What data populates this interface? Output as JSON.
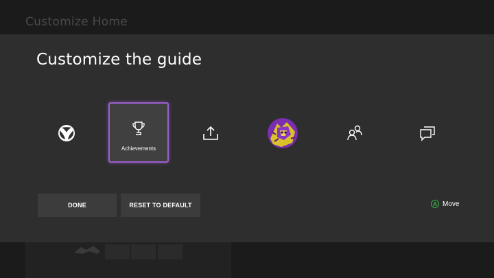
{
  "background": {
    "title": "Customize Home"
  },
  "dialog": {
    "title": "Customize the guide",
    "items": [
      {
        "icon": "xbox-logo-icon",
        "label": ""
      },
      {
        "icon": "trophy-icon",
        "label": "Achievements",
        "selected": true
      },
      {
        "icon": "share-upload-icon",
        "label": ""
      },
      {
        "icon": "profile-avatar",
        "label": ""
      },
      {
        "icon": "people-icon",
        "label": ""
      },
      {
        "icon": "chat-icon",
        "label": ""
      }
    ],
    "buttons": {
      "done": "DONE",
      "reset": "RESET TO DEFAULT"
    },
    "hint": {
      "badge": "A",
      "label": "Move"
    }
  },
  "colors": {
    "selection_border": "#9c5fd1",
    "a_button": "#34b34a",
    "dialog_bg": "#2e2e2e"
  }
}
